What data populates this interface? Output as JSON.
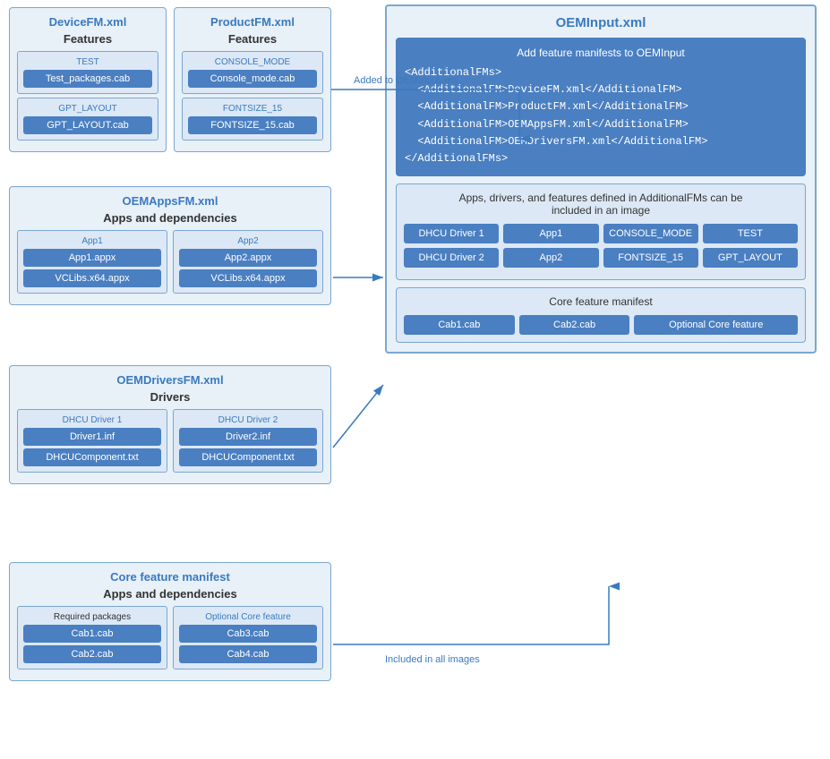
{
  "deviceFM": {
    "title": "DeviceFM.xml",
    "subtitle": "Features",
    "features": [
      {
        "label": "TEST",
        "packages": [
          "Test_packages.cab"
        ]
      },
      {
        "label": "GPT_LAYOUT",
        "packages": [
          "GPT_LAYOUT.cab"
        ]
      }
    ]
  },
  "productFM": {
    "title": "ProductFM.xml",
    "subtitle": "Features",
    "features": [
      {
        "label": "CONSOLE_MODE",
        "packages": [
          "Console_mode.cab"
        ]
      },
      {
        "label": "FONTSIZE_15",
        "packages": [
          "FONTSIZE_15.cab"
        ]
      }
    ]
  },
  "oemAppsFM": {
    "title": "OEMAppsFM.xml",
    "subtitle": "Apps and dependencies",
    "apps": [
      {
        "label": "App1",
        "packages": [
          "App1.appx",
          "VCLibs.x64.appx"
        ]
      },
      {
        "label": "App2",
        "packages": [
          "App2.appx",
          "VCLibs.x64.appx"
        ]
      }
    ]
  },
  "oemDriversFM": {
    "title": "OEMDriversFM.xml",
    "subtitle": "Drivers",
    "drivers": [
      {
        "label": "DHCU Driver 1",
        "packages": [
          "Driver1.inf",
          "DHCUComponent.txt"
        ]
      },
      {
        "label": "DHCU Driver 2",
        "packages": [
          "Driver2.inf",
          "DHCUComponent.txt"
        ]
      }
    ]
  },
  "coreFM": {
    "title": "Core feature manifest",
    "subtitle": "Apps and dependencies",
    "required_label": "Required packages",
    "optional_label": "Optional Core feature",
    "required_packages": [
      "Cab1.cab",
      "Cab2.cab"
    ],
    "optional_packages": [
      "Cab3.cab",
      "Cab4.cab"
    ]
  },
  "oemInput": {
    "title": "OEMInput.xml",
    "addfm_header": "Add feature manifests to OEMInput",
    "addfm_code": "<AdditionalFMs>\n  <AdditionalFM>DeviceFM.xml</AdditionalFM>\n  <AdditionalFM>ProductFM.xml</AdditionalFM>\n  <AdditionalFM>OEMAppsFM.xml</AdditionalFM>\n  <AdditionalFM>OEMDriversFM.xml</AdditionalFM>\n</AdditionalFMs>",
    "apps_section_title": "Apps, drivers, and features defined in AdditionalFMs can be\nincluded in an image",
    "apps_grid_row1": [
      "DHCU Driver 1",
      "App1",
      "CONSOLE_MODE",
      "TEST"
    ],
    "apps_grid_row2": [
      "DHCU Driver 2",
      "App2",
      "FONTSIZE_15",
      "GPT_LAYOUT"
    ],
    "core_section_title": "Core feature manifest",
    "core_items": [
      "Cab1.cab",
      "Cab2.cab",
      "Optional Core feature"
    ]
  },
  "arrows": {
    "added_label": "Added to OEMInput.xml",
    "included_label": "Included in all images"
  }
}
